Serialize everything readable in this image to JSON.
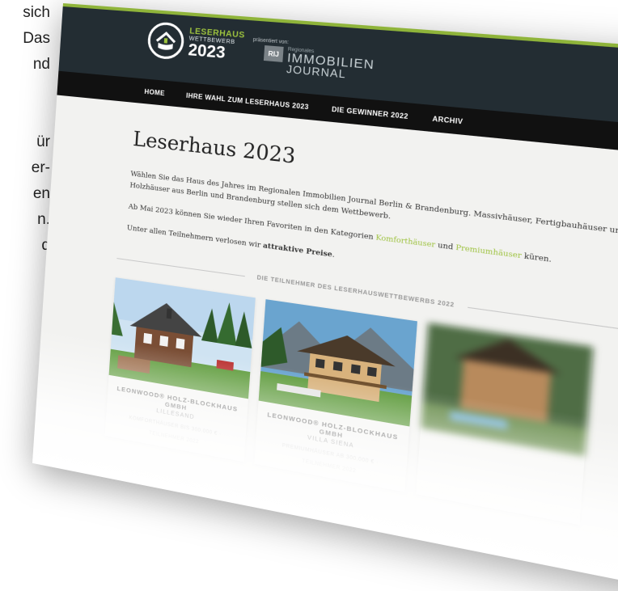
{
  "background_text": {
    "lines": [
      "sich",
      "Das",
      "nd",
      "",
      "",
      "ür",
      "er-",
      "en",
      "n.",
      "d"
    ]
  },
  "header": {
    "logo": {
      "line1": "LESERHAUS",
      "line2": "WETTBEWERB",
      "year": "2023"
    },
    "presented_by": "präsentiert von:",
    "partner": {
      "badge": "RIJ",
      "small": "Regionales",
      "line1": "IMMOBILIEN",
      "line2": "JOURNAL"
    }
  },
  "nav": {
    "items": [
      "HOME",
      "IHRE WAHL ZUM LESERHAUS 2023",
      "DIE GEWINNER 2022",
      "ARCHIV"
    ]
  },
  "main": {
    "title": "Leserhaus 2023",
    "intro": "Wählen Sie das Haus des Jahres im Regionalen Immobilien Journal Berlin & Brandenburg. Massivhäuser, Fertigbauhäuser und Holzhäuser aus Berlin und Brandenburg stellen sich dem Wettbewerb.",
    "para2_before": "Ab Mai 2023 können Sie wieder Ihren Favoriten in den Kategorien ",
    "para2_cat1": "Komforthäuser",
    "para2_mid": " und ",
    "para2_cat2": "Premiumhäuser",
    "para2_after": " küren.",
    "para3_before": "Unter allen Teilnehmern verlosen wir ",
    "para3_bold": "attraktive Preise",
    "para3_after": "."
  },
  "section": {
    "heading": "DIE TEILNEHMER DES LESERHAUSWETTBEWERBS 2022"
  },
  "cards": [
    {
      "company": "LEONWOOD® HOLZ-BLOCKHAUS GMBH",
      "house": "LILLESAND",
      "meta1": "KOMFORTHÄUSER BIS 300.000 € ·",
      "meta2": "TEILNEHMER 2022"
    },
    {
      "company": "LEONWOOD® HOLZ-BLOCKHAUS GMBH",
      "house": "VILLA SIENA",
      "meta1": "PREMIUMHÄUSER AB 300.000 € ·",
      "meta2": "TEILNEHMER 2022"
    }
  ],
  "colors": {
    "header_bg": "#232d33",
    "nav_bg": "#111111",
    "accent_green": "#9dc23e",
    "page_bg": "#f2f2f0"
  }
}
